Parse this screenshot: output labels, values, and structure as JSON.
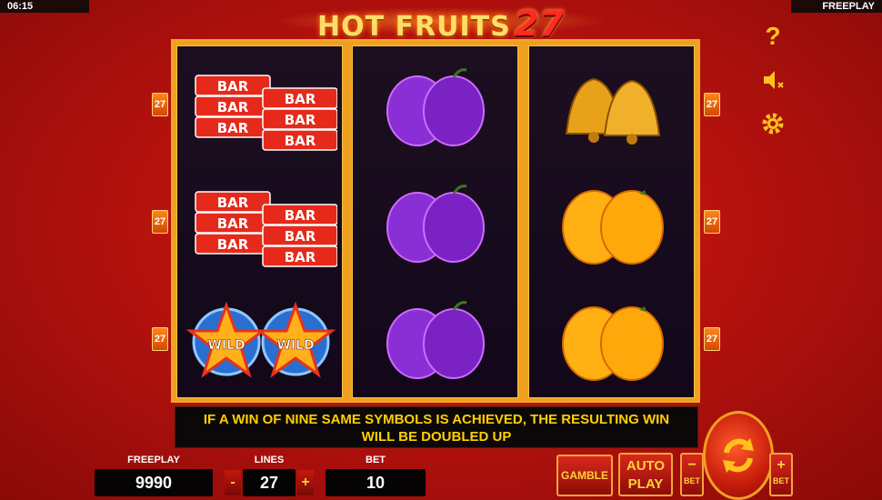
{
  "status_bar": {
    "time": "06:15",
    "mode": "FREEPLAY"
  },
  "title": {
    "main": "HOT FRUITS",
    "number": "27"
  },
  "line_badges": {
    "left": [
      "27",
      "27",
      "27"
    ],
    "right": [
      "27",
      "27",
      "27"
    ]
  },
  "reels": [
    {
      "name": "reel-1",
      "symbols": [
        "bar",
        "bar",
        "wild"
      ]
    },
    {
      "name": "reel-2",
      "symbols": [
        "plum",
        "plum",
        "plum"
      ]
    },
    {
      "name": "reel-3",
      "symbols": [
        "bell",
        "orange",
        "orange"
      ]
    }
  ],
  "symbol_text": {
    "bar": "BAR",
    "wild": "WILD"
  },
  "side_controls": {
    "help_icon": "question-icon",
    "sound_icon": "speaker-muted-icon",
    "settings_icon": "gear-icon"
  },
  "message": {
    "line1": "IF A WIN OF NINE SAME SYMBOLS IS ACHIEVED, THE RESULTING WIN",
    "line2": "WILL BE DOUBLED UP"
  },
  "bottom_panel": {
    "freeplay_label": "FREEPLAY",
    "freeplay_value": "9990",
    "lines_label": "LINES",
    "lines_value": "27",
    "bet_label": "BET",
    "bet_value": "10",
    "minus": "-",
    "plus": "+"
  },
  "buttons": {
    "gamble": "GAMBLE",
    "autoplay_1": "AUTO",
    "autoplay_2": "PLAY",
    "bet_minus_label": "BET",
    "bet_plus_label": "BET"
  },
  "colors": {
    "accent": "#f4a52a",
    "message_text": "#ffd000",
    "background": "#b8120e"
  }
}
